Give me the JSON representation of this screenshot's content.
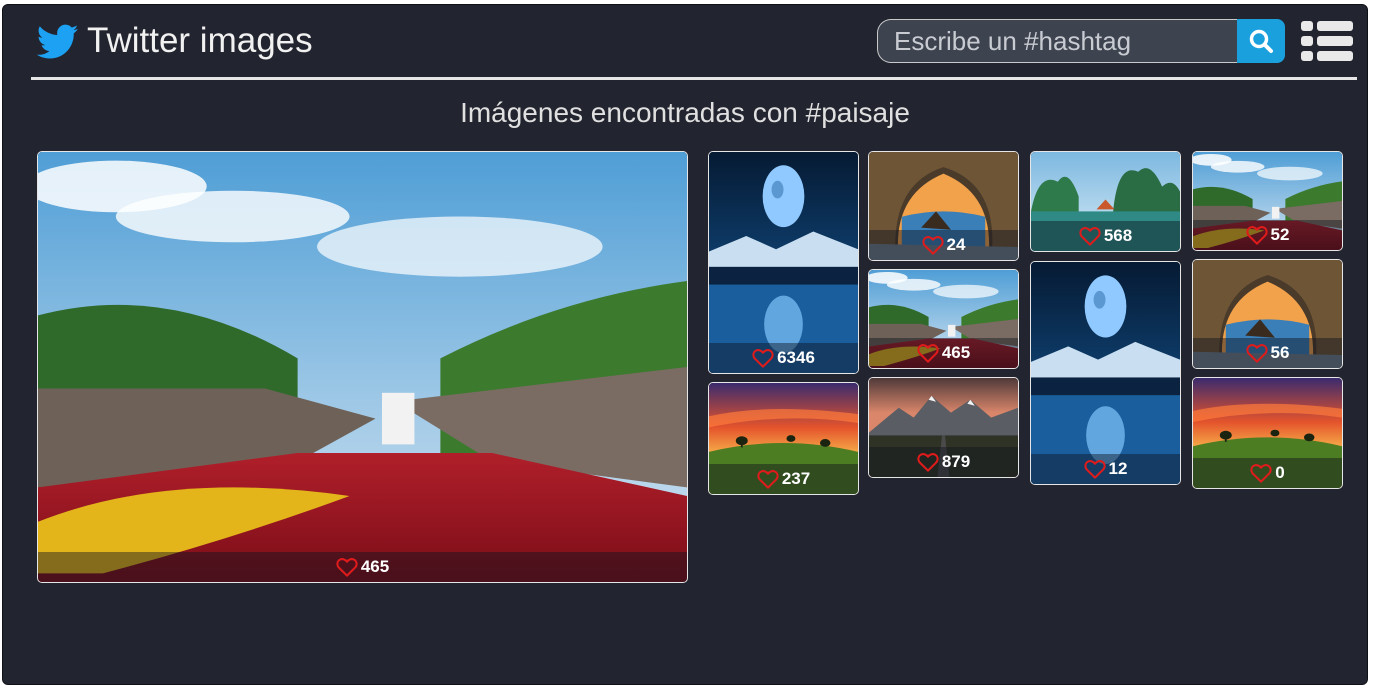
{
  "header": {
    "app_title": "Twitter images",
    "logo_icon": "twitter-bird-icon",
    "search_placeholder": "Escribe un #hashtag",
    "search_value": "",
    "search_icon": "search-icon",
    "menu_icon": "list-view-icon"
  },
  "results": {
    "heading": "Imágenes encontradas con #paisaje"
  },
  "colors": {
    "background": "#22242f",
    "accent": "#1aa0dd",
    "like_heart": "#e01b1b"
  },
  "images": [
    {
      "scene": "red-river-canyon",
      "likes": "465"
    },
    {
      "scene": "blue-moon-lake",
      "likes": "6346"
    },
    {
      "scene": "sunset-hill",
      "likes": "237"
    },
    {
      "scene": "sea-cave-sunset",
      "likes": "24"
    },
    {
      "scene": "red-river-canyon",
      "likes": "465"
    },
    {
      "scene": "mountain-road",
      "likes": "879"
    },
    {
      "scene": "karst-bay",
      "likes": "568"
    },
    {
      "scene": "blue-moon-lake",
      "likes": "12"
    },
    {
      "scene": "red-river-canyon",
      "likes": "52"
    },
    {
      "scene": "sea-cave-sunset",
      "likes": "56"
    },
    {
      "scene": "sunset-hill",
      "likes": "0"
    }
  ]
}
